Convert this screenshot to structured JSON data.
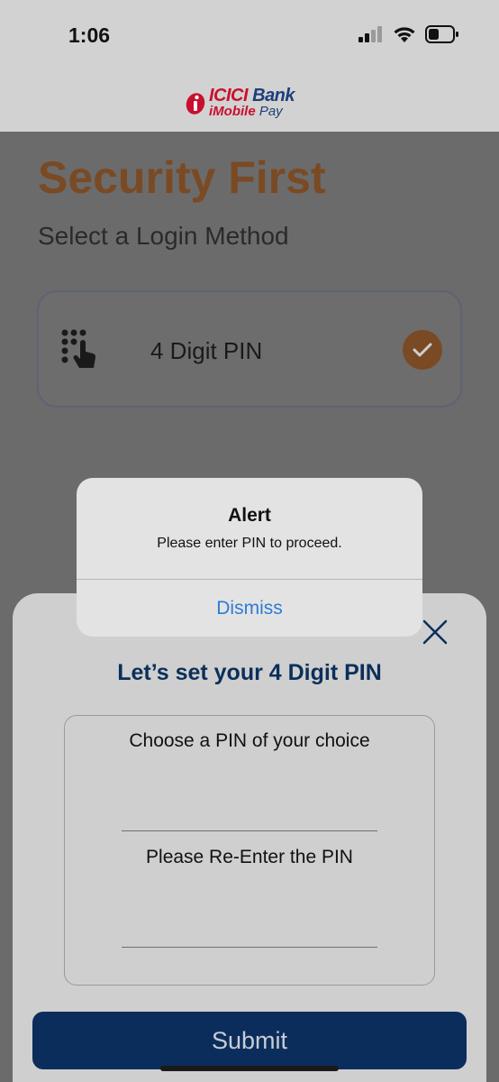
{
  "status_bar": {
    "time": "1:06"
  },
  "brand": {
    "name_icici": "ICICI",
    "name_bank": " Bank",
    "name_imobile": "iMobile",
    "name_pay": " Pay"
  },
  "page": {
    "title": "Security First",
    "subtitle": "Select a Login Method",
    "login_option": {
      "label": "4 Digit PIN",
      "icon": "keypad-touch-icon",
      "selected": true
    }
  },
  "sheet": {
    "title": "Let’s set your 4 Digit PIN",
    "pin_label": "Choose a PIN of your choice",
    "pin_value": "",
    "reenter_label": "Please Re-Enter the PIN",
    "reenter_value": "",
    "submit_label": "Submit"
  },
  "alert": {
    "title": "Alert",
    "message": "Please enter PIN to proceed.",
    "button_label": "Dismiss"
  },
  "colors": {
    "accent_brown": "#7a4a24",
    "navy": "#0b2d5c",
    "link_blue": "#2f7bd6"
  }
}
